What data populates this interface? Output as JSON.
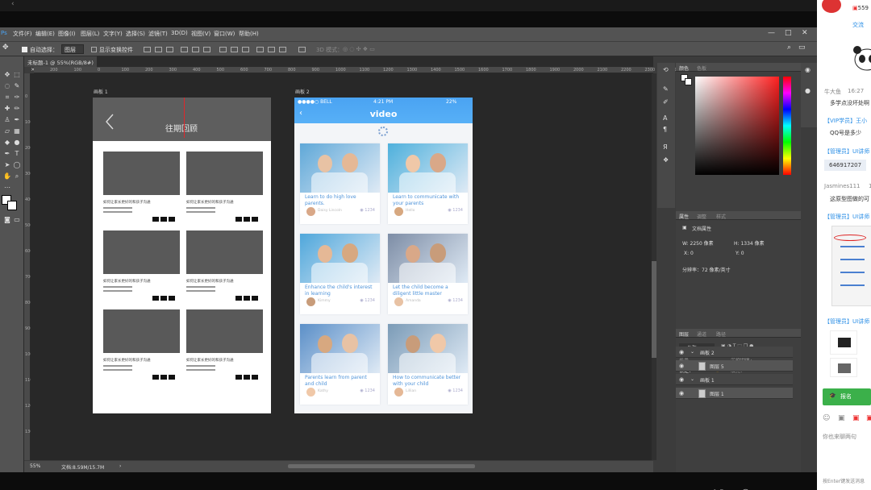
{
  "window": {
    "menu": [
      "文件(F)",
      "编辑(E)",
      "图像(I)",
      "图层(L)",
      "文字(Y)",
      "选择(S)",
      "滤镜(T)",
      "3D(D)",
      "视图(V)",
      "窗口(W)",
      "帮助(H)"
    ],
    "controls": {
      "minimize": "—",
      "restore": "□",
      "close": "✕"
    }
  },
  "options_bar": {
    "auto_select_label": "自动选择：",
    "auto_select_value": "图层",
    "show_transform_label": "显示变换控件",
    "mode_label": "3D 模式："
  },
  "document": {
    "tab_label": "未标题-1 @ 55%(RGB/8#)",
    "tab_close": "×",
    "zoom": "55%",
    "doc_size": "文档:8.59M/15.7M"
  },
  "rulers": {
    "top": [
      "200",
      "100",
      "0",
      "100",
      "200",
      "300",
      "400",
      "500",
      "600",
      "700",
      "800",
      "900",
      "1000",
      "1100",
      "1200",
      "1300",
      "1400",
      "1500",
      "1600",
      "1700",
      "1800",
      "1900",
      "2000",
      "2100",
      "2200",
      "2300",
      "2400"
    ],
    "left": [
      "0",
      "100",
      "200",
      "300",
      "400",
      "500",
      "600",
      "700",
      "800",
      "900",
      "1000",
      "1100",
      "1200",
      "1300"
    ]
  },
  "artboard1": {
    "label": "画板 1",
    "title": "往期回顾",
    "back": "‹",
    "card_caption": "如何让家长更好的和孩子沟通"
  },
  "artboard2": {
    "label": "画板 2",
    "carrier": "●●●●○ BELL",
    "time": "4:21 PM",
    "battery": "22%",
    "title": "video",
    "back": "‹",
    "cards": [
      {
        "caption": "Learn to do high love parents.",
        "author": "Daisy Lincoln",
        "views": "1234"
      },
      {
        "caption": "Learn to communicate with your parents",
        "author": "Hello",
        "views": "1234"
      },
      {
        "caption": "Enhance the child's interest in learning",
        "author": "Kimmy",
        "views": "1234"
      },
      {
        "caption": "Let the child become a diligent little master",
        "author": "Amanda",
        "views": "1234"
      },
      {
        "caption": "Parents learn from parent and child",
        "author": "Kathy",
        "views": "1234"
      },
      {
        "caption": "How to communicate better with your child",
        "author": "Lillian",
        "views": "1234"
      }
    ]
  },
  "panels": {
    "color_tabs": [
      "颜色",
      "色板"
    ],
    "props_tabs": [
      "属性",
      "调整",
      "样式"
    ],
    "doc_props": "文档属性",
    "w_label": "W: 2250 像素",
    "h_label": "H: 1334 像素",
    "x_label": "X: 0",
    "y_label": "Y: 0",
    "resolution": "分辨率：72 像素/英寸",
    "layers_tabs": [
      "图层",
      "通道",
      "路径"
    ],
    "kind": "ρ 类型",
    "blend": "正常",
    "opacity": "不透明度：",
    "lock": "锁定：",
    "fill": "填充：",
    "layers": [
      {
        "name": "画板 2",
        "group": true
      },
      {
        "name": "图层 5",
        "group": false
      },
      {
        "name": "画板 1",
        "group": true
      },
      {
        "name": "图层 1",
        "group": false
      }
    ]
  },
  "chat": {
    "top_num": "559",
    "exchange": "交流",
    "messages": [
      {
        "who": "牛大鱼",
        "time": "16:27",
        "text": "多学点没坏处啊"
      },
      {
        "who": "【VIP学员】王小",
        "text": "QQ号是多少"
      },
      {
        "who": "【管理员】UI讲师",
        "text": "646917207"
      },
      {
        "who": "Jasmines111",
        "time": "16",
        "text": "这原型图做的可"
      },
      {
        "who": "【管理员】UI讲师",
        "text": ""
      },
      {
        "who": "【管理员】UI讲师",
        "text": ""
      }
    ],
    "signup": "报名",
    "input_placeholder": "你也来聊两句",
    "hint": "按Enter键发送消息"
  },
  "colors": {
    "ps_bg": "#3c3c3c",
    "canvas": "#282828",
    "accent_blue": "#4aa3f2",
    "chat_green": "#3bb04a",
    "guide_red": "#e0262b"
  }
}
